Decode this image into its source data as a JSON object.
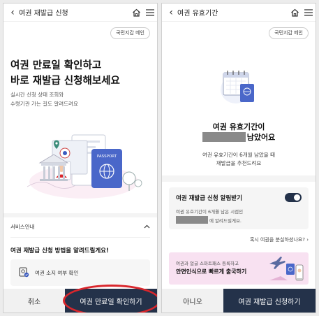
{
  "left": {
    "title": "여권 재발급 신청",
    "chip": "국민지갑 메인",
    "hero_line1": "여권 만료일 확인하고",
    "hero_line2": "바로 재발급 신청해보세요",
    "sub_line1": "실시간 신청 상태 조회와",
    "sub_line2": "수령기관 가는 길도 알려드려요",
    "passport_text": "PASSPORT",
    "service_info": "서비스안내",
    "guide_title": "여권 재발급 신청 방법을 알려드릴게요!",
    "step1": "여권 소지 여부 확인",
    "cancel": "취소",
    "confirm": "여권 만료일 확인하기"
  },
  "right": {
    "title": "여권 유효기간",
    "chip": "국민지갑 메인",
    "heading_line1": "여권 유효기간이",
    "heading_line2_suffix": "남았어요",
    "desc_line1": "여권 유효기간이 6개월 남았을 때",
    "desc_line2": "재발급을 추천드려요",
    "alert_title": "여권 재발급 신청 알림받기",
    "alert_line1": "여권 유효기간이 6개월 남은 시점인",
    "alert_line2_suffix": "에 알려드릴게요.",
    "lost_link": "혹시 여권을 분실하셨나요?",
    "banner_line1": "여권과 얼굴 스마트패스 등록하고",
    "banner_line2": "안면인식으로 빠르게 출국하기",
    "no": "아니오",
    "apply": "여권 재발급 신청하기"
  },
  "colors": {
    "primary": "#24324a",
    "passport_blue": "#4a67c9",
    "highlight_circle": "#d9262c",
    "banner_pink": "#f8e1f1"
  }
}
